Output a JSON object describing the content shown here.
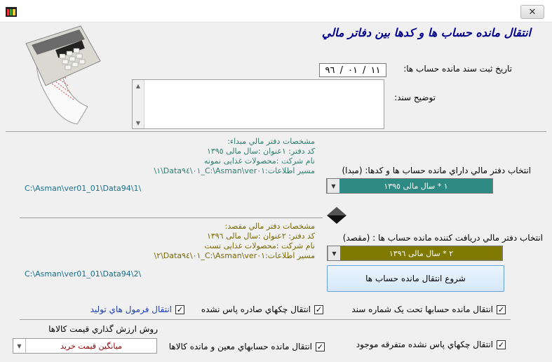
{
  "window": {
    "close_symbol": "✕",
    "app_icon": "app-icon"
  },
  "title": "انتقال مانده حساب ها و کدها بين دفاتر مالي",
  "date": {
    "label": "تاريخ ثبت سند مانده حساب ها:",
    "day": "١١",
    "month": "٠١",
    "year": "٩٦"
  },
  "description": {
    "label": "توضيح سند:",
    "value": ""
  },
  "source": {
    "heading": "مشخصات دفتر مالي مبداء:",
    "code_line": "کد دفتر: ١عنوان      :سال مالی ١٣٩٥",
    "company_line": "نام شرکت  :محصولات غذایی نمونه",
    "path_line": "مسير اطلاعات:C:\\Asman\\ver٠١_٠١\\Data٩٤\\١\\",
    "select_label": "انتخاب دفتر مالي داراي مانده حساب ها و کدها: (مبدا)",
    "select_value": "١ * سال مالی ١٣٩٥",
    "path": "C:\\Asman\\ver01_01\\Data94\\1\\"
  },
  "destination": {
    "heading": "مشخصات دفتر مالي مقصد:",
    "code_line": "کد دفتر: ٢عنوان      :سال مالی ١٣٩٦",
    "company_line": "نام شرکت  :محصولات غذایی تست",
    "path_line": "مسير اطلاعات:C:\\Asman\\ver٠١_٠١\\Data٩٤\\٢\\",
    "select_label": "انتخاب دفتر مالي دريافت کننده مانده حساب ها : (مقصد)",
    "select_value": "٢ * سال مالی ١٣٩٦",
    "path": "C:\\Asman\\ver01_01\\Data94\\2\\"
  },
  "start_button": "شروع انتقال مانده حساب ها",
  "options": {
    "opt1": {
      "label": "انتقال مانده حسابها تحت يک شماره سند",
      "checked": true
    },
    "opt2": {
      "label": "انتقال چکهاي صادره پاس نشده",
      "checked": true
    },
    "opt3": {
      "label": "انتقال فرمول هاي توليد",
      "checked": true
    },
    "opt4": {
      "label": "انتقال چکهاي پاس نشده متفرقه موجود",
      "checked": true
    },
    "opt5": {
      "label": "انتقال مانده حسابهاي معين و مانده کالاها",
      "checked": true
    }
  },
  "valuation": {
    "label": "روش ارزش گذاري قيمت کالاها",
    "value": "ميانگين قيمت خريد"
  },
  "colors": {
    "source_select": "#2e8b83",
    "dest_select": "#807a00",
    "title": "#00008b"
  }
}
